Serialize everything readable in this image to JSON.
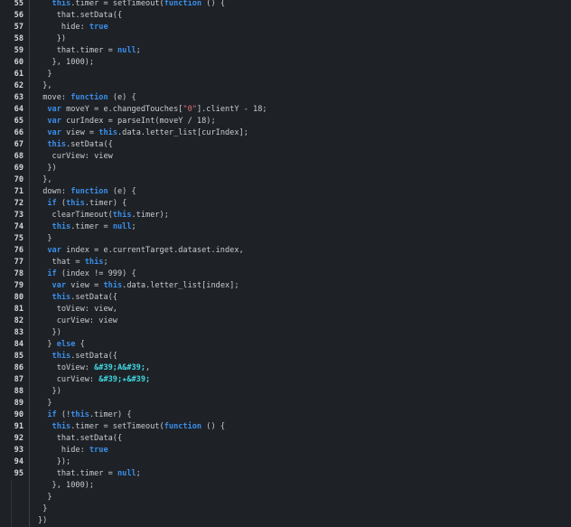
{
  "editor": {
    "lines": [
      {
        "num": "55",
        "indent": "   ",
        "tokens": [
          {
            "t": "this",
            "c": "kw"
          },
          {
            "t": ".timer = setTimeout("
          },
          {
            "t": "function",
            "c": "kw"
          },
          {
            "t": " () {"
          }
        ]
      },
      {
        "num": "56",
        "indent": "    ",
        "tokens": [
          {
            "t": "that.setData({"
          }
        ]
      },
      {
        "num": "57",
        "indent": "     ",
        "tokens": [
          {
            "t": "hide: "
          },
          {
            "t": "true",
            "c": "kw"
          }
        ]
      },
      {
        "num": "58",
        "indent": "    ",
        "tokens": [
          {
            "t": "})"
          }
        ]
      },
      {
        "num": "59",
        "indent": "    ",
        "tokens": [
          {
            "t": "that.timer = "
          },
          {
            "t": "null",
            "c": "kw"
          },
          {
            "t": ";"
          }
        ]
      },
      {
        "num": "60",
        "indent": "   ",
        "tokens": [
          {
            "t": "}, 1000);"
          }
        ]
      },
      {
        "num": "61",
        "indent": "  ",
        "tokens": [
          {
            "t": "}"
          }
        ]
      },
      {
        "num": "62",
        "indent": " ",
        "tokens": [
          {
            "t": "},"
          }
        ]
      },
      {
        "num": "63",
        "indent": " ",
        "tokens": [
          {
            "t": "move: "
          },
          {
            "t": "function",
            "c": "kw"
          },
          {
            "t": " (e) {"
          }
        ]
      },
      {
        "num": "64",
        "indent": "  ",
        "tokens": [
          {
            "t": "var",
            "c": "kw"
          },
          {
            "t": " moveY = e.changedTouches["
          },
          {
            "t": "\"0\"",
            "c": "str"
          },
          {
            "t": "].clientY - 18;"
          }
        ]
      },
      {
        "num": "65",
        "indent": "  ",
        "tokens": [
          {
            "t": "var",
            "c": "kw"
          },
          {
            "t": " curIndex = parseInt(moveY / 18);"
          }
        ]
      },
      {
        "num": "66",
        "indent": "  ",
        "tokens": [
          {
            "t": "var",
            "c": "kw"
          },
          {
            "t": " view = "
          },
          {
            "t": "this",
            "c": "kw"
          },
          {
            "t": ".data.letter_list[curIndex];"
          }
        ]
      },
      {
        "num": "67",
        "indent": "  ",
        "tokens": [
          {
            "t": "this",
            "c": "kw"
          },
          {
            "t": ".setData({"
          }
        ]
      },
      {
        "num": "68",
        "indent": "   ",
        "tokens": [
          {
            "t": "curView: view"
          }
        ]
      },
      {
        "num": "69",
        "indent": "  ",
        "tokens": [
          {
            "t": "})"
          }
        ]
      },
      {
        "num": "70",
        "indent": " ",
        "tokens": [
          {
            "t": "},"
          }
        ]
      },
      {
        "num": "71",
        "indent": " ",
        "tokens": [
          {
            "t": "down: "
          },
          {
            "t": "function",
            "c": "kw"
          },
          {
            "t": " (e) {"
          }
        ]
      },
      {
        "num": "72",
        "indent": "  ",
        "tokens": [
          {
            "t": "if",
            "c": "kw"
          },
          {
            "t": " ("
          },
          {
            "t": "this",
            "c": "kw"
          },
          {
            "t": ".timer) {"
          }
        ]
      },
      {
        "num": "73",
        "indent": "   ",
        "tokens": [
          {
            "t": "clearTimeout("
          },
          {
            "t": "this",
            "c": "kw"
          },
          {
            "t": ".timer);"
          }
        ]
      },
      {
        "num": "74",
        "indent": "   ",
        "tokens": [
          {
            "t": "this",
            "c": "kw"
          },
          {
            "t": ".timer = "
          },
          {
            "t": "null",
            "c": "kw"
          },
          {
            "t": ";"
          }
        ]
      },
      {
        "num": "75",
        "indent": "  ",
        "tokens": [
          {
            "t": "}"
          }
        ]
      },
      {
        "num": "76",
        "indent": "  ",
        "tokens": [
          {
            "t": "var",
            "c": "kw"
          },
          {
            "t": " index = e.currentTarget.dataset.index,"
          }
        ]
      },
      {
        "num": "77",
        "indent": "   ",
        "tokens": [
          {
            "t": "that = "
          },
          {
            "t": "this",
            "c": "kw"
          },
          {
            "t": ";"
          }
        ]
      },
      {
        "num": "78",
        "indent": "  ",
        "tokens": [
          {
            "t": "if",
            "c": "kw"
          },
          {
            "t": " (index != 999) {"
          }
        ]
      },
      {
        "num": "79",
        "indent": "   ",
        "tokens": [
          {
            "t": "var",
            "c": "kw"
          },
          {
            "t": " view = "
          },
          {
            "t": "this",
            "c": "kw"
          },
          {
            "t": ".data.letter_list[index];"
          }
        ]
      },
      {
        "num": "80",
        "indent": "   ",
        "tokens": [
          {
            "t": "this",
            "c": "kw"
          },
          {
            "t": ".setData({"
          }
        ]
      },
      {
        "num": "81",
        "indent": "    ",
        "tokens": [
          {
            "t": "toView: view,"
          }
        ]
      },
      {
        "num": "82",
        "indent": "    ",
        "tokens": [
          {
            "t": "curView: view"
          }
        ]
      },
      {
        "num": "83",
        "indent": "   ",
        "tokens": [
          {
            "t": "})"
          }
        ]
      },
      {
        "num": "84",
        "indent": "  ",
        "tokens": [
          {
            "t": "} "
          },
          {
            "t": "else",
            "c": "kw"
          },
          {
            "t": " {"
          }
        ]
      },
      {
        "num": "85",
        "indent": "   ",
        "tokens": [
          {
            "t": "this",
            "c": "kw"
          },
          {
            "t": ".setData({"
          }
        ]
      },
      {
        "num": "86",
        "indent": "    ",
        "tokens": [
          {
            "t": "toView: "
          },
          {
            "t": "&#39;A&#39;",
            "c": "ent"
          },
          {
            "t": ","
          }
        ]
      },
      {
        "num": "87",
        "indent": "    ",
        "tokens": [
          {
            "t": "curView: "
          },
          {
            "t": "&#39;★&#39;",
            "c": "ent"
          }
        ]
      },
      {
        "num": "88",
        "indent": "   ",
        "tokens": [
          {
            "t": "})"
          }
        ]
      },
      {
        "num": "89",
        "indent": "  ",
        "tokens": [
          {
            "t": "}"
          }
        ]
      },
      {
        "num": "90",
        "indent": "  ",
        "tokens": [
          {
            "t": "if",
            "c": "kw"
          },
          {
            "t": " (!"
          },
          {
            "t": "this",
            "c": "kw"
          },
          {
            "t": ".timer) {"
          }
        ]
      },
      {
        "num": "91",
        "indent": "   ",
        "tokens": [
          {
            "t": "this",
            "c": "kw"
          },
          {
            "t": ".timer = setTimeout("
          },
          {
            "t": "function",
            "c": "kw"
          },
          {
            "t": " () {"
          }
        ]
      },
      {
        "num": "92",
        "indent": "    ",
        "tokens": [
          {
            "t": "that.setData({"
          }
        ]
      },
      {
        "num": "93",
        "indent": "     ",
        "tokens": [
          {
            "t": "hide: "
          },
          {
            "t": "true",
            "c": "kw"
          }
        ]
      },
      {
        "num": "94",
        "indent": "    ",
        "tokens": [
          {
            "t": "});"
          }
        ]
      },
      {
        "num": "95",
        "indent": "    ",
        "tokens": [
          {
            "t": "that.timer = "
          },
          {
            "t": "null",
            "c": "kw"
          },
          {
            "t": ";"
          }
        ]
      },
      {
        "num": "",
        "indent": "   ",
        "tokens": [
          {
            "t": "}, 1000);"
          }
        ]
      },
      {
        "num": "",
        "indent": "  ",
        "tokens": [
          {
            "t": "}"
          }
        ]
      },
      {
        "num": "",
        "indent": " ",
        "tokens": [
          {
            "t": "}"
          }
        ]
      },
      {
        "num": "",
        "indent": "",
        "tokens": [
          {
            "t": "})"
          }
        ]
      }
    ]
  }
}
